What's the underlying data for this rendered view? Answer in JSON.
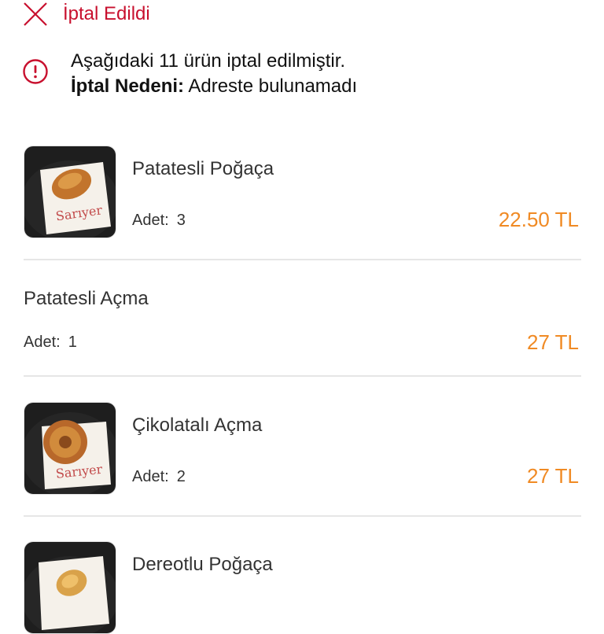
{
  "status": {
    "title": "İptal Edildi",
    "icon": "close-icon",
    "color": "#c8102e"
  },
  "notice": {
    "icon": "info-circle-icon",
    "message": "Aşağıdaki 11 ürün iptal edilmiştir.",
    "reason_label": "İptal Nedeni:",
    "reason_value": "Adreste bulunamadı"
  },
  "qty_label": "Adet:",
  "price_color": "#f08a24",
  "items": [
    {
      "name": "Patatesli Poğaça",
      "qty": "3",
      "price": "22.50 TL",
      "image": "pogaca-image"
    },
    {
      "name": "Patatesli Açma",
      "qty": "1",
      "price": "27 TL"
    },
    {
      "name": "Çikolatalı Açma",
      "qty": "2",
      "price": "27 TL",
      "image": "acma-image"
    },
    {
      "name": "Dereotlu Poğaça",
      "image": "pogaca-image"
    }
  ]
}
